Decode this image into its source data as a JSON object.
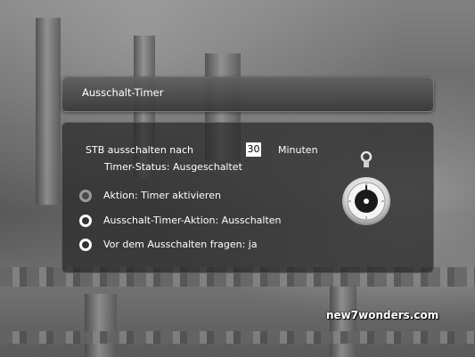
{
  "dialog": {
    "title": "Ausschalt-Timer"
  },
  "settings": {
    "shutdown_label": "STB ausschalten nach",
    "shutdown_value": "30",
    "shutdown_unit": "Minuten",
    "timer_status": "Timer-Status: Ausgeschaltet",
    "options": [
      {
        "label": "Aktion: Timer aktivieren"
      },
      {
        "label": "Ausschalt-Timer-Aktion: Ausschalten"
      },
      {
        "label": "Vor dem Ausschalten fragen: ja"
      }
    ]
  },
  "icons": {
    "stopwatch": "stopwatch-icon"
  },
  "watermark": "new7wonders.com"
}
